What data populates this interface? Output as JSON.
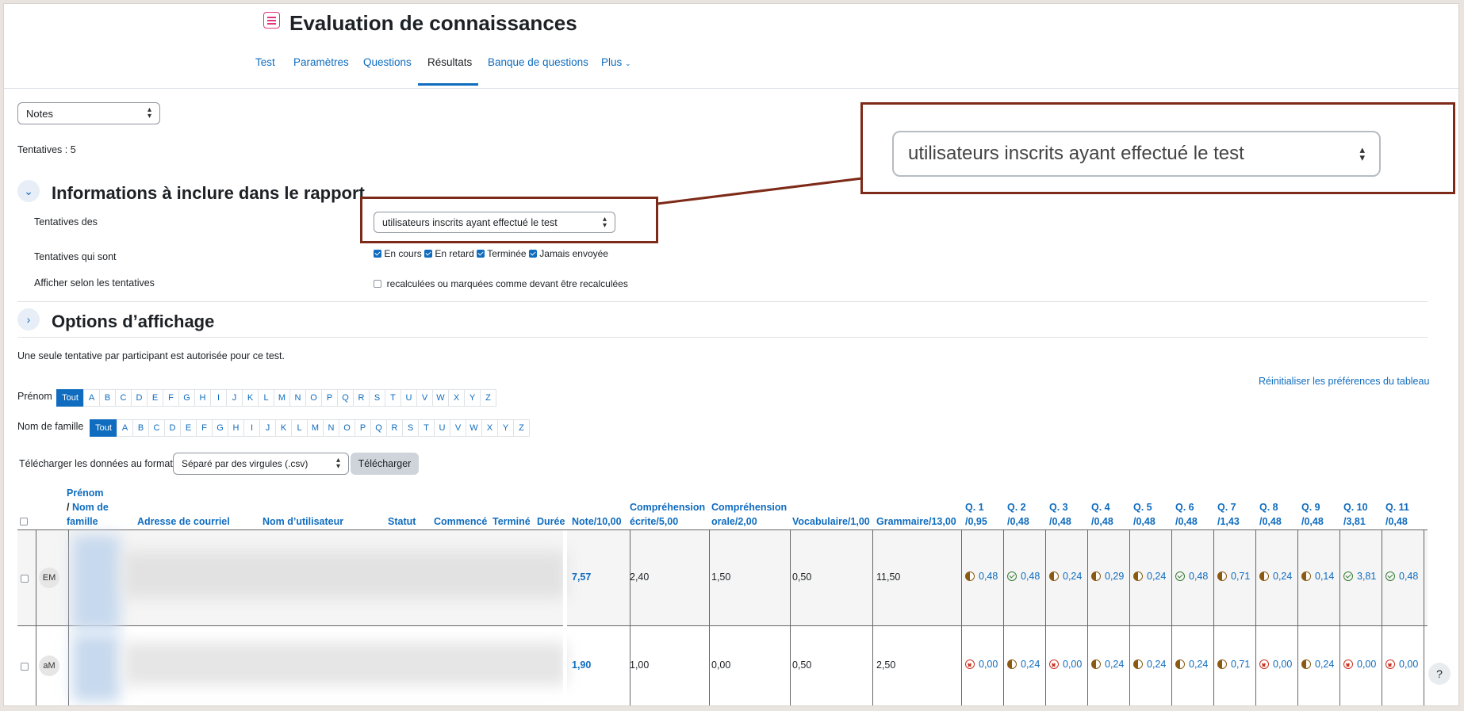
{
  "page": {
    "title": "Evaluation de connaissances"
  },
  "tabs": [
    {
      "label": "Test"
    },
    {
      "label": "Paramètres"
    },
    {
      "label": "Questions"
    },
    {
      "label": "Résultats"
    },
    {
      "label": "Banque de questions"
    },
    {
      "label": "Plus"
    }
  ],
  "report_select": {
    "value": "Notes"
  },
  "attempts_count": "Tentatives : 5",
  "section_include": {
    "title": "Informations à inclure dans le rapport",
    "attempts_from_label": "Tentatives des",
    "attempts_from_value": "utilisateurs inscrits ayant effectué le test",
    "attempts_state_label": "Tentatives qui sont",
    "states": [
      {
        "label": "En cours",
        "checked": true
      },
      {
        "label": "En retard",
        "checked": true
      },
      {
        "label": "Terminée",
        "checked": true
      },
      {
        "label": "Jamais envoyée",
        "checked": true
      }
    ],
    "show_by_label": "Afficher selon les tentatives",
    "show_by_option": "recalculées ou marquées comme devant être recalculées"
  },
  "section_display": {
    "title": "Options d’affichage"
  },
  "notice": "Une seule tentative par participant est autorisée pour ce test.",
  "reset_link": "Réinitialiser les préférences du tableau",
  "firstname_filter": {
    "label": "Prénom",
    "all": "Tout",
    "letters": [
      "A",
      "B",
      "C",
      "D",
      "E",
      "F",
      "G",
      "H",
      "I",
      "J",
      "K",
      "L",
      "M",
      "N",
      "O",
      "P",
      "Q",
      "R",
      "S",
      "T",
      "U",
      "V",
      "W",
      "X",
      "Y",
      "Z"
    ]
  },
  "lastname_filter": {
    "label": "Nom de famille",
    "all": "Tout",
    "letters": [
      "A",
      "B",
      "C",
      "D",
      "E",
      "F",
      "G",
      "H",
      "I",
      "J",
      "K",
      "L",
      "M",
      "N",
      "O",
      "P",
      "Q",
      "R",
      "S",
      "T",
      "U",
      "V",
      "W",
      "X",
      "Y",
      "Z"
    ]
  },
  "download": {
    "label": "Télécharger les données au format",
    "format": "Séparé par des virgules (.csv)",
    "button": "Télécharger"
  },
  "callout": {
    "text": "utilisateurs inscrits ayant effectué le test"
  },
  "table": {
    "headers": {
      "firstname": "Prénom",
      "slash": "/",
      "lastname_1": "Nom de",
      "lastname_2": "famille",
      "email": "Adresse de courriel",
      "username": "Nom d’utilisateur",
      "status": "Statut",
      "started": "Commencé",
      "finished": "Terminé",
      "duration": "Durée",
      "grade": "Note/10,00",
      "written_1": "Compréhension",
      "written_2": "écrite/5,00",
      "oral_1": "Compréhension",
      "oral_2": "orale/2,00",
      "vocab": "Vocabulaire/1,00",
      "grammar": "Grammaire/13,00",
      "questions": [
        {
          "q": "Q. 1",
          "max": "/0,95"
        },
        {
          "q": "Q. 2",
          "max": "/0,48"
        },
        {
          "q": "Q. 3",
          "max": "/0,48"
        },
        {
          "q": "Q. 4",
          "max": "/0,48"
        },
        {
          "q": "Q. 5",
          "max": "/0,48"
        },
        {
          "q": "Q. 6",
          "max": "/0,48"
        },
        {
          "q": "Q. 7",
          "max": "/1,43"
        },
        {
          "q": "Q. 8",
          "max": "/0,48"
        },
        {
          "q": "Q. 9",
          "max": "/0,48"
        },
        {
          "q": "Q. 10",
          "max": "/3,81"
        },
        {
          "q": "Q. 11",
          "max": "/0,48"
        }
      ]
    },
    "rows": [
      {
        "initials": "EM",
        "grade": "7,57",
        "written": "2,40",
        "oral": "1,50",
        "vocab": "0,50",
        "grammar": "11,50",
        "questions": [
          {
            "state": "partial",
            "value": "0,48"
          },
          {
            "state": "correct",
            "value": "0,48"
          },
          {
            "state": "partial",
            "value": "0,24"
          },
          {
            "state": "partial",
            "value": "0,29"
          },
          {
            "state": "partial",
            "value": "0,24"
          },
          {
            "state": "correct",
            "value": "0,48"
          },
          {
            "state": "partial",
            "value": "0,71"
          },
          {
            "state": "partial",
            "value": "0,24"
          },
          {
            "state": "partial",
            "value": "0,14"
          },
          {
            "state": "correct",
            "value": "3,81"
          },
          {
            "state": "correct",
            "value": "0,48"
          }
        ]
      },
      {
        "initials": "aM",
        "grade": "1,90",
        "written": "1,00",
        "oral": "0,00",
        "vocab": "0,50",
        "grammar": "2,50",
        "questions": [
          {
            "state": "incorrect",
            "value": "0,00"
          },
          {
            "state": "partial",
            "value": "0,24"
          },
          {
            "state": "incorrect",
            "value": "0,00"
          },
          {
            "state": "partial",
            "value": "0,24"
          },
          {
            "state": "partial",
            "value": "0,24"
          },
          {
            "state": "partial",
            "value": "0,24"
          },
          {
            "state": "partial",
            "value": "0,71"
          },
          {
            "state": "incorrect",
            "value": "0,00"
          },
          {
            "state": "partial",
            "value": "0,24"
          },
          {
            "state": "incorrect",
            "value": "0,00"
          },
          {
            "state": "incorrect",
            "value": "0,00"
          }
        ]
      }
    ]
  },
  "help_button": "?"
}
